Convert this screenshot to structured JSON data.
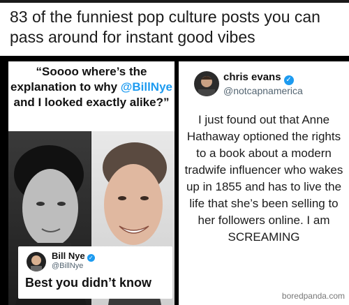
{
  "headline": "83 of the funniest pop culture posts you can pass around for instant good vibes",
  "left_panel": {
    "quote_before": "“Soooo where’s the explanation to why ",
    "quote_mention": "@BillNye",
    "quote_after": " and I looked exactly alike?”",
    "card": {
      "name": "Bill Nye",
      "handle": "@BillNye",
      "text": "Best you didn’t know"
    }
  },
  "right_panel": {
    "name": "chris evans",
    "handle": "@notcapnamerica",
    "tweet": "I just found out that Anne Hathaway optioned the rights to a book about a modern tradwife influencer who wakes up in 1855 and has to live the life that she’s been selling to her followers online. I am SCREAMING",
    "watermark": "boredpanda.com"
  },
  "colors": {
    "mention": "#1d9bf0",
    "verified": "#1d9bf0",
    "divider": "#000000"
  }
}
